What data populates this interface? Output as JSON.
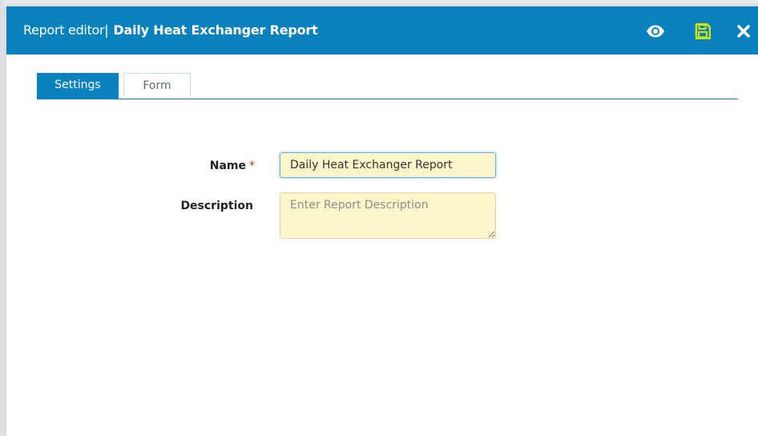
{
  "header": {
    "prefix": "Report editor|",
    "report_name": "Daily Heat Exchanger Report",
    "icons": {
      "preview": "eye-icon",
      "save": "save-icon",
      "close": "close-icon"
    },
    "colors": {
      "bar": "#0b82be",
      "save_icon": "#d7e600"
    }
  },
  "tabs": [
    {
      "label": "Settings",
      "active": true
    },
    {
      "label": "Form",
      "active": false
    }
  ],
  "form": {
    "name": {
      "label": "Name",
      "required_marker": "*",
      "value": "Daily Heat Exchanger Report"
    },
    "description": {
      "label": "Description",
      "value": "",
      "placeholder": "Enter Report Description"
    }
  }
}
